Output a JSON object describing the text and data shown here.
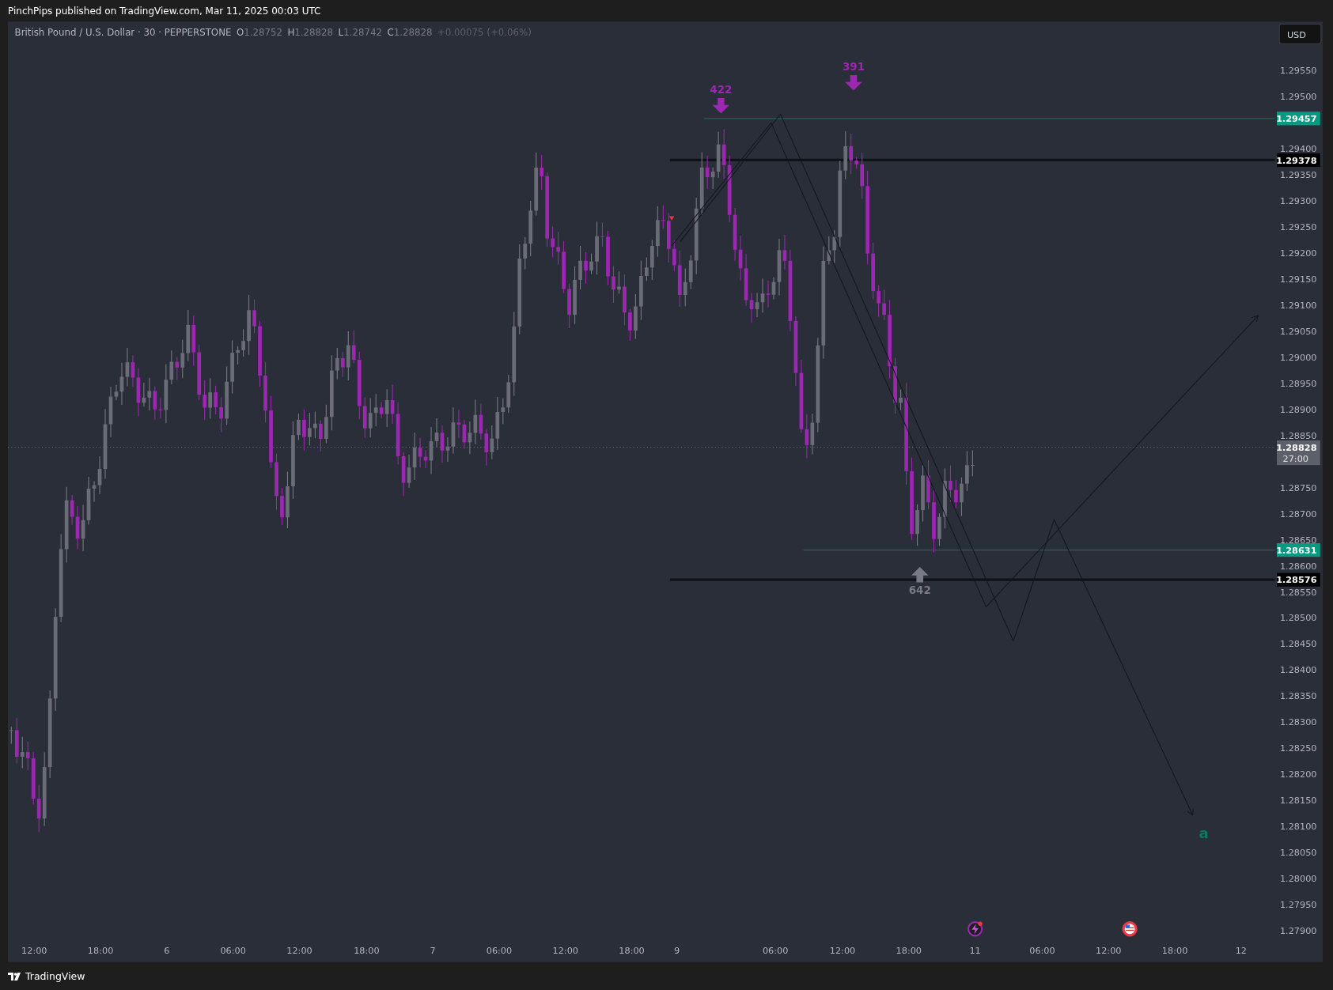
{
  "publish_line": "PinchPips published on TradingView.com, Mar 11, 2025 00:03 UTC",
  "symbol": {
    "title": "British Pound / U.S. Dollar · 30 · PEPPERSTONE",
    "ohlc": [
      {
        "label": "O",
        "value": "1.28752"
      },
      {
        "label": "H",
        "value": "1.28828"
      },
      {
        "label": "L",
        "value": "1.28742"
      },
      {
        "label": "C",
        "value": "1.28828"
      }
    ],
    "change": "+0.00075 (+0.06%)"
  },
  "currency_button": "USD",
  "price_ticks": [
    "1.29550",
    "1.29500",
    "1.29400",
    "1.29350",
    "1.29300",
    "1.29250",
    "1.29200",
    "1.29150",
    "1.29100",
    "1.29050",
    "1.29000",
    "1.28950",
    "1.28900",
    "1.28850",
    "1.28750",
    "1.28700",
    "1.28650",
    "1.28600",
    "1.28550",
    "1.28500",
    "1.28450",
    "1.28400",
    "1.28350",
    "1.28300",
    "1.28250",
    "1.28200",
    "1.28150",
    "1.28100",
    "1.28050",
    "1.28000",
    "1.27950",
    "1.27900"
  ],
  "price_tags": [
    {
      "kind": "level",
      "text": "1.29457",
      "color": "#089981"
    },
    {
      "kind": "level",
      "text": "1.29378",
      "color": "#000000"
    },
    {
      "kind": "current",
      "text": "1.28828",
      "countdown": "27:00"
    },
    {
      "kind": "level",
      "text": "1.28631",
      "color": "#089981"
    },
    {
      "kind": "level",
      "text": "1.28576",
      "color": "#000000"
    }
  ],
  "markers": [
    {
      "text": "422",
      "kind": "down",
      "color": "#9c27b0"
    },
    {
      "text": "391",
      "kind": "down",
      "color": "#9c27b0"
    },
    {
      "text": "642",
      "kind": "up",
      "color": "#787b86"
    }
  ],
  "wave_label": "a",
  "time_labels": [
    "12:00",
    "18:00",
    "6",
    "06:00",
    "12:00",
    "18:00",
    "7",
    "06:00",
    "12:00",
    "18:00",
    "9",
    "06:00",
    "12:00",
    "18:00",
    "11",
    "06:00",
    "12:00",
    "18:00",
    "12"
  ],
  "footer": "TradingView"
}
